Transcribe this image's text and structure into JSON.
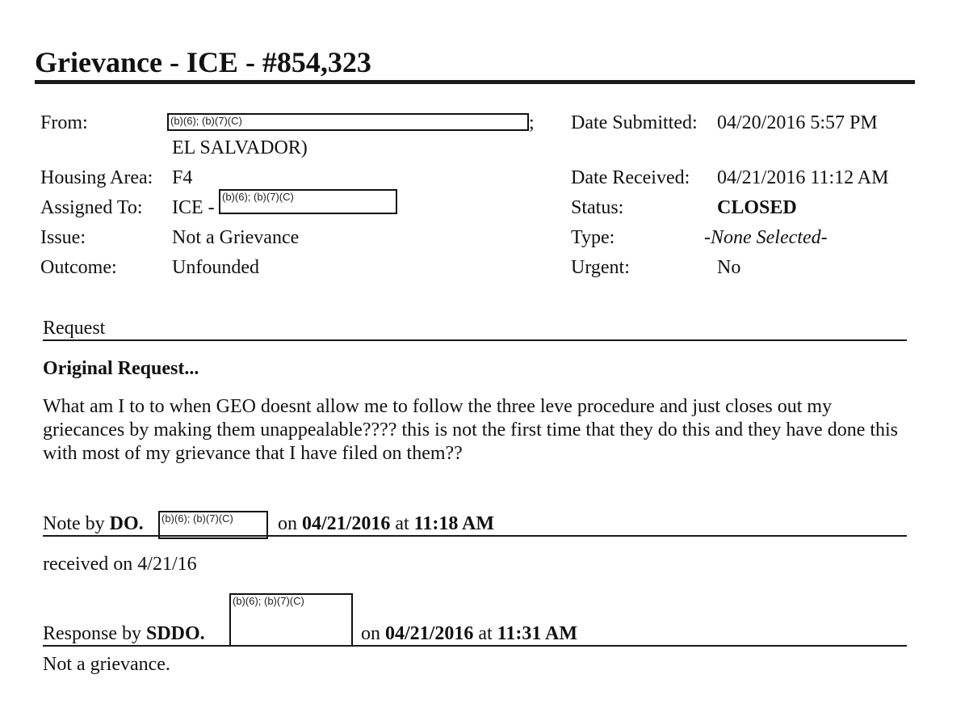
{
  "document": {
    "title": "Grievance - ICE - #854,323",
    "redaction_code": "(b)(6); (b)(7)(C)",
    "left_fields": {
      "from": {
        "label": "From:",
        "value_suffix": ";",
        "value_line2": "EL SALVADOR)"
      },
      "housing_area": {
        "label": "Housing Area:",
        "value": "F4"
      },
      "assigned_to": {
        "label": "Assigned To:",
        "value_prefix": "ICE -"
      },
      "issue": {
        "label": "Issue:",
        "value": "Not a Grievance"
      },
      "outcome": {
        "label": "Outcome:",
        "value": "Unfounded"
      }
    },
    "right_fields": {
      "date_submitted": {
        "label": "Date Submitted:",
        "value": "04/20/2016 5:57 PM"
      },
      "date_received": {
        "label": "Date Received:",
        "value": "04/21/2016 11:12 AM"
      },
      "status": {
        "label": "Status:",
        "value": "CLOSED"
      },
      "type": {
        "label": "Type:",
        "value": "-None Selected-"
      },
      "urgent": {
        "label": "Urgent:",
        "value": "No"
      }
    },
    "request": {
      "section_label": "Request",
      "heading": "Original Request...",
      "body": "What am I to to when GEO doesnt allow me to follow the three leve procedure and just closes out my griecances by making them unappealable???? this is not the first time that they do this and they have done this with most of my grievance that I have filed on them??"
    },
    "note": {
      "prefix": "Note by",
      "role": "DO.",
      "on_text": "on",
      "date": "04/21/2016",
      "at_text": "at",
      "time": "11:18 AM",
      "body": "received on 4/21/16"
    },
    "response": {
      "prefix": "Response by",
      "role": "SDDO.",
      "on_text": "on",
      "date": "04/21/2016",
      "at_text": "at",
      "time": "11:31 AM",
      "body": "Not a grievance."
    }
  }
}
